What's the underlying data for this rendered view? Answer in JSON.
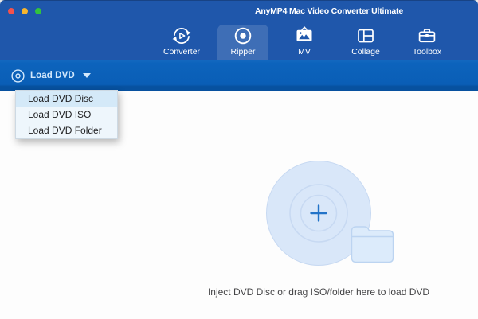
{
  "window": {
    "title": "AnyMP4 Mac Video Converter Ultimate"
  },
  "nav": {
    "tabs": [
      {
        "label": "Converter",
        "active": false
      },
      {
        "label": "Ripper",
        "active": true
      },
      {
        "label": "MV",
        "active": false
      },
      {
        "label": "Collage",
        "active": false
      },
      {
        "label": "Toolbox",
        "active": false
      }
    ]
  },
  "toolbar": {
    "load_dvd_label": "Load DVD"
  },
  "dropdown": {
    "items": [
      "Load DVD Disc",
      "Load DVD ISO",
      "Load DVD Folder"
    ],
    "selected_index": 0
  },
  "main": {
    "hint": "Inject DVD Disc or drag ISO/folder here to load DVD"
  },
  "icons": {
    "converter": "circular-sync-arrows-with-play",
    "ripper": "disc-with-center-dot",
    "mv": "tv-with-mountains",
    "collage": "split-grid-frame",
    "toolbox": "briefcase",
    "load_dvd": "disc-outline",
    "dropdown_caret": "triangle-down",
    "drop_area": "disc-with-plus-and-folder"
  },
  "colors": {
    "header_blue": "#1f57ab",
    "toolbar_blue": "#0c63bc",
    "active_tab_highlight": "rgba(255,255,255,0.14)",
    "menu_bg": "#eef6fc",
    "menu_selected": "#d4e9f8",
    "disc_fill": "#d9e7f9",
    "disc_ring": "#c7d9f2",
    "plus_blue": "#2273c8",
    "traffic_red": "#f2524d",
    "traffic_yellow": "#f6b52e",
    "traffic_green": "#32c33e"
  }
}
